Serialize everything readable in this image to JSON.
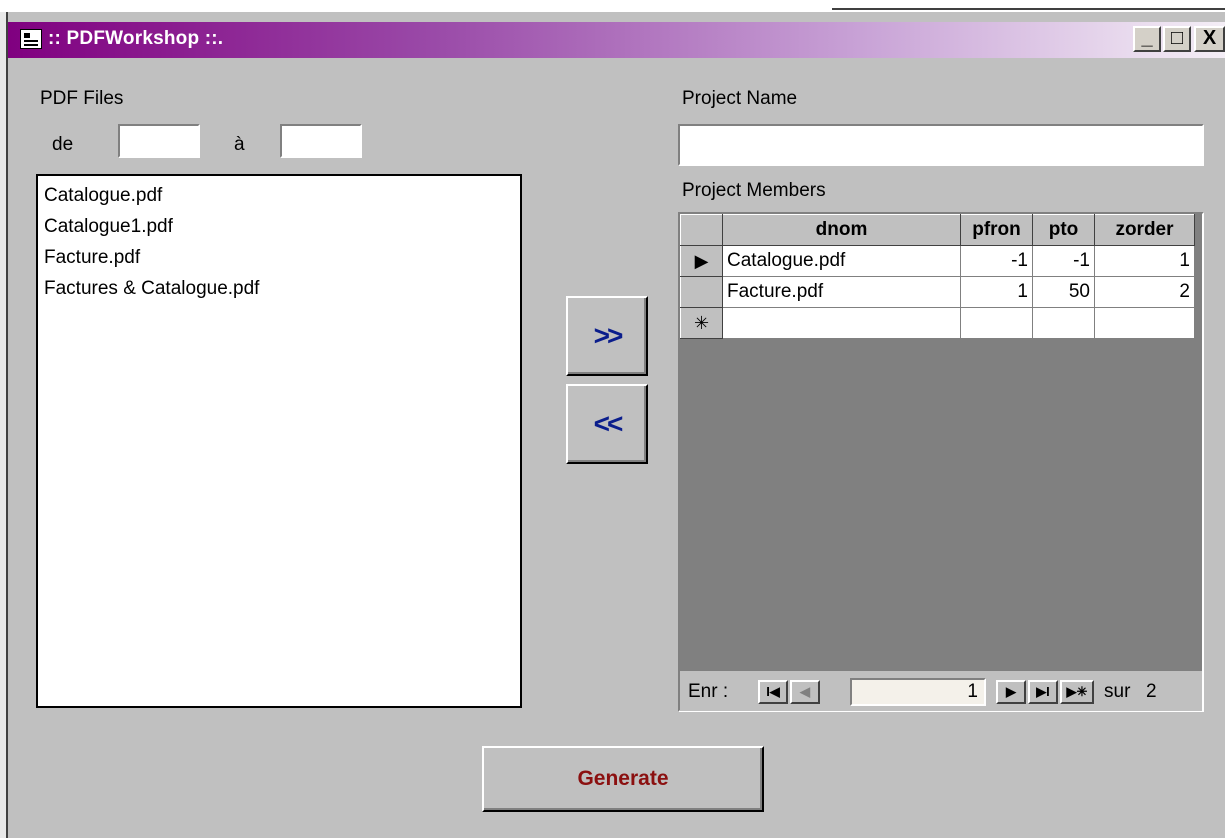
{
  "window": {
    "title": ":: PDFWorkshop ::.",
    "controls": {
      "minimize": "_",
      "maximize": "□",
      "close": "X"
    }
  },
  "left": {
    "pdf_files_label": "PDF Files",
    "from_label": "de",
    "to_label": "à",
    "from_value": "",
    "to_value": "",
    "files": [
      "Catalogue.pdf",
      "Catalogue1.pdf",
      "Facture.pdf",
      "Factures &  Catalogue.pdf"
    ]
  },
  "middle": {
    "add_label": ">>",
    "remove_label": "<<"
  },
  "right": {
    "project_name_label": "Project Name",
    "project_name_value": "",
    "project_members_label": "Project Members",
    "columns": [
      "dnom",
      "pfron",
      "pto",
      "zorder"
    ],
    "rows": [
      {
        "selector": "▶",
        "dnom": "Catalogue.pdf",
        "pfron": "-1",
        "pto": "-1",
        "zorder": "1"
      },
      {
        "selector": "",
        "dnom": "Facture.pdf",
        "pfron": "1",
        "pto": "50",
        "zorder": "2"
      },
      {
        "selector": "✳",
        "dnom": "",
        "pfron": "",
        "pto": "",
        "zorder": ""
      }
    ],
    "navigation": {
      "record_label": "Enr :",
      "first": "I◀",
      "prev": "◀",
      "current": "1",
      "next": "▶",
      "last": "▶I",
      "new": "▶✳",
      "of_label": "sur",
      "total": "2"
    }
  },
  "footer": {
    "generate_label": "Generate"
  },
  "colors": {
    "title_gradient_start": "#800080",
    "arrow_color": "#0a1d8c",
    "generate_text": "#8b1010",
    "face": "#c0c0c0"
  }
}
